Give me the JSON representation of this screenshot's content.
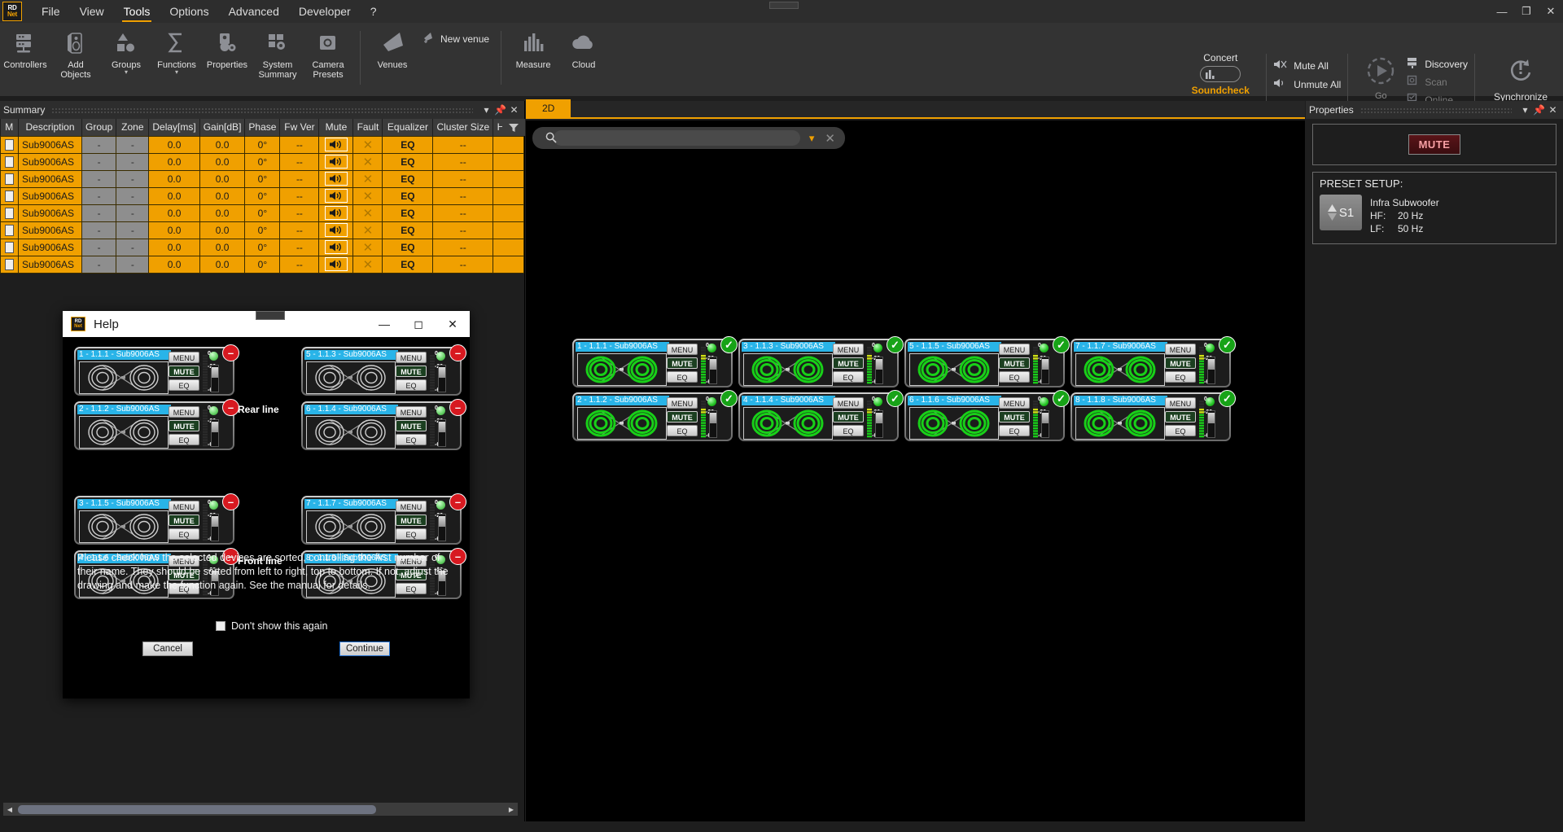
{
  "app": {
    "logo_line1": "RD",
    "logo_line2": "Net",
    "menu": [
      "File",
      "View",
      "Tools",
      "Options",
      "Advanced",
      "Developer",
      "?"
    ],
    "active_menu": "Tools",
    "window_controls": [
      "minimize",
      "restore",
      "close"
    ]
  },
  "ribbon": {
    "buttons": [
      {
        "label": "Controllers",
        "icon": "controllers-icon"
      },
      {
        "label": "Add\nObjects",
        "icon": "add-objects-icon"
      },
      {
        "label": "Groups",
        "icon": "groups-icon",
        "chevron": true
      },
      {
        "label": "Functions",
        "icon": "functions-icon",
        "chevron": true
      },
      {
        "label": "Properties",
        "icon": "properties-icon"
      },
      {
        "label": "System\nSummary",
        "icon": "system-summary-icon"
      },
      {
        "label": "Camera\nPresets",
        "icon": "camera-presets-icon"
      }
    ],
    "venues": {
      "label": "Venues",
      "new_venue": "New venue"
    },
    "measure": {
      "label": "Measure"
    },
    "cloud": {
      "label": "Cloud"
    },
    "mode_toggle": {
      "top": "Concert",
      "bottom": "Soundcheck",
      "state": "soundcheck"
    },
    "mute_all": "Mute All",
    "unmute_all": "Unmute All",
    "go": "Go",
    "discovery": "Discovery",
    "scan": "Scan",
    "online": "Online",
    "synchronize": "Synchronize"
  },
  "summary": {
    "title": "Summary",
    "columns": [
      "M",
      "Description",
      "Group",
      "Zone",
      "Delay[ms]",
      "Gain[dB]",
      "Phase",
      "Fw Ver",
      "Mute",
      "Fault",
      "Equalizer",
      "Cluster Size",
      "HF C"
    ],
    "rows": [
      {
        "description": "Sub9006AS",
        "group": "-",
        "zone": "-",
        "delay": "0.0",
        "gain": "0.0",
        "phase": "0°",
        "fw": "--",
        "mute": "speaker-icon",
        "fault": "x-icon",
        "eq": "EQ",
        "cluster": "--",
        "hfc": ""
      },
      {
        "description": "Sub9006AS",
        "group": "-",
        "zone": "-",
        "delay": "0.0",
        "gain": "0.0",
        "phase": "0°",
        "fw": "--",
        "mute": "speaker-icon",
        "fault": "x-icon",
        "eq": "EQ",
        "cluster": "--",
        "hfc": ""
      },
      {
        "description": "Sub9006AS",
        "group": "-",
        "zone": "-",
        "delay": "0.0",
        "gain": "0.0",
        "phase": "0°",
        "fw": "--",
        "mute": "speaker-icon",
        "fault": "x-icon",
        "eq": "EQ",
        "cluster": "--",
        "hfc": ""
      },
      {
        "description": "Sub9006AS",
        "group": "-",
        "zone": "-",
        "delay": "0.0",
        "gain": "0.0",
        "phase": "0°",
        "fw": "--",
        "mute": "speaker-icon",
        "fault": "x-icon",
        "eq": "EQ",
        "cluster": "--",
        "hfc": ""
      },
      {
        "description": "Sub9006AS",
        "group": "-",
        "zone": "-",
        "delay": "0.0",
        "gain": "0.0",
        "phase": "0°",
        "fw": "--",
        "mute": "speaker-icon",
        "fault": "x-icon",
        "eq": "EQ",
        "cluster": "--",
        "hfc": ""
      },
      {
        "description": "Sub9006AS",
        "group": "-",
        "zone": "-",
        "delay": "0.0",
        "gain": "0.0",
        "phase": "0°",
        "fw": "--",
        "mute": "speaker-icon",
        "fault": "x-icon",
        "eq": "EQ",
        "cluster": "--",
        "hfc": ""
      },
      {
        "description": "Sub9006AS",
        "group": "-",
        "zone": "-",
        "delay": "0.0",
        "gain": "0.0",
        "phase": "0°",
        "fw": "--",
        "mute": "speaker-icon",
        "fault": "x-icon",
        "eq": "EQ",
        "cluster": "--",
        "hfc": ""
      },
      {
        "description": "Sub9006AS",
        "group": "-",
        "zone": "-",
        "delay": "0.0",
        "gain": "0.0",
        "phase": "0°",
        "fw": "--",
        "mute": "speaker-icon",
        "fault": "x-icon",
        "eq": "EQ",
        "cluster": "--",
        "hfc": ""
      }
    ]
  },
  "center": {
    "tab_label": "2D",
    "search_value": "",
    "search_placeholder": ""
  },
  "devices_2d": [
    {
      "title": "1 - 1.1.1 - Sub9006AS",
      "menu": "MENU",
      "mute": "MUTE",
      "eq": "EQ",
      "scale_top": "0",
      "scale_mid": "-20",
      "scale_bot": "-60",
      "status": "ok"
    },
    {
      "title": "2 - 1.1.2 - Sub9006AS",
      "menu": "MENU",
      "mute": "MUTE",
      "eq": "EQ",
      "scale_top": "0",
      "scale_mid": "-20",
      "scale_bot": "-60",
      "status": "ok"
    },
    {
      "title": "3 - 1.1.3 - Sub9006AS",
      "menu": "MENU",
      "mute": "MUTE",
      "eq": "EQ",
      "scale_top": "0",
      "scale_mid": "-20",
      "scale_bot": "-60",
      "status": "ok"
    },
    {
      "title": "4 - 1.1.4 - Sub9006AS",
      "menu": "MENU",
      "mute": "MUTE",
      "eq": "EQ",
      "scale_top": "0",
      "scale_mid": "-20",
      "scale_bot": "-60",
      "status": "ok"
    },
    {
      "title": "5 - 1.1.5 - Sub9006AS",
      "menu": "MENU",
      "mute": "MUTE",
      "eq": "EQ",
      "scale_top": "0",
      "scale_mid": "-20",
      "scale_bot": "-60",
      "status": "ok"
    },
    {
      "title": "6 - 1.1.6 - Sub9006AS",
      "menu": "MENU",
      "mute": "MUTE",
      "eq": "EQ",
      "scale_top": "0",
      "scale_mid": "-20",
      "scale_bot": "-60",
      "status": "ok"
    },
    {
      "title": "7 - 1.1.7 - Sub9006AS",
      "menu": "MENU",
      "mute": "MUTE",
      "eq": "EQ",
      "scale_top": "0",
      "scale_mid": "-20",
      "scale_bot": "-60",
      "status": "ok"
    },
    {
      "title": "8 - 1.1.8 - Sub9006AS",
      "menu": "MENU",
      "mute": "MUTE",
      "eq": "EQ",
      "scale_top": "0",
      "scale_mid": "-20",
      "scale_bot": "-60",
      "status": "ok"
    }
  ],
  "properties": {
    "title": "Properties",
    "mute_label": "MUTE",
    "preset_title": "PRESET SETUP:",
    "preset_slot": "S1",
    "preset_name": "Infra Subwoofer",
    "hf_key": "HF:",
    "hf_value": "20 Hz",
    "lf_key": "LF:",
    "lf_value": "50 Hz"
  },
  "help_dialog": {
    "title": "Help",
    "logo_line1": "RD",
    "logo_line2": "Net",
    "devices": [
      {
        "title": "1 - 1.1.1 - Sub9006AS",
        "menu": "MENU",
        "mute": "MUTE",
        "eq": "EQ",
        "scale_top": "0",
        "scale_mid": "-20",
        "scale_bot": "-60",
        "status": "stop"
      },
      {
        "title": "2 - 1.1.2 - Sub9006AS",
        "menu": "MENU",
        "mute": "MUTE",
        "eq": "EQ",
        "scale_top": "0",
        "scale_mid": "-20",
        "scale_bot": "-60",
        "status": "stop"
      },
      {
        "title": "5 - 1.1.3 - Sub9006AS",
        "menu": "MENU",
        "mute": "MUTE",
        "eq": "EQ",
        "scale_top": "0",
        "scale_mid": "-20",
        "scale_bot": "-60",
        "status": "stop"
      },
      {
        "title": "6 - 1.1.4 - Sub9006AS",
        "menu": "MENU",
        "mute": "MUTE",
        "eq": "EQ",
        "scale_top": "0",
        "scale_mid": "-20",
        "scale_bot": "-60",
        "status": "stop"
      },
      {
        "title": "3 - 1.1.5 - Sub9006AS",
        "menu": "MENU",
        "mute": "MUTE",
        "eq": "EQ",
        "scale_top": "0",
        "scale_mid": "-20",
        "scale_bot": "-60",
        "status": "stop"
      },
      {
        "title": "4 - 1.1.6 - Sub9006AS",
        "menu": "MENU",
        "mute": "MUTE",
        "eq": "EQ",
        "scale_top": "0",
        "scale_mid": "-20",
        "scale_bot": "-60",
        "status": "stop"
      },
      {
        "title": "7 - 1.1.7 - Sub9006AS",
        "menu": "MENU",
        "mute": "MUTE",
        "eq": "EQ",
        "scale_top": "0",
        "scale_mid": "-20",
        "scale_bot": "-60",
        "status": "stop"
      },
      {
        "title": "8 - 1.1.8 - Sub9006AS",
        "menu": "MENU",
        "mute": "MUTE",
        "eq": "EQ",
        "scale_top": "0",
        "scale_mid": "-20",
        "scale_bot": "-60",
        "status": "stop"
      }
    ],
    "rear_line_label": "Rear line",
    "front_line_label": "Front line",
    "body_text": "Please check how the selected devices are sorted, controlling the first number of their name. They should be sorted from left to right, top to bottom. If not, adjust the drawing and make the function again. See the manual for details.",
    "dont_show_label": "Don't show this again",
    "cancel_label": "Cancel",
    "continue_label": "Continue"
  },
  "colors": {
    "accent": "#f0a000",
    "row_highlight": "#f0a000",
    "device_title": "#29b4e8",
    "ok_green": "#17a317",
    "stop_red": "#d71920"
  }
}
